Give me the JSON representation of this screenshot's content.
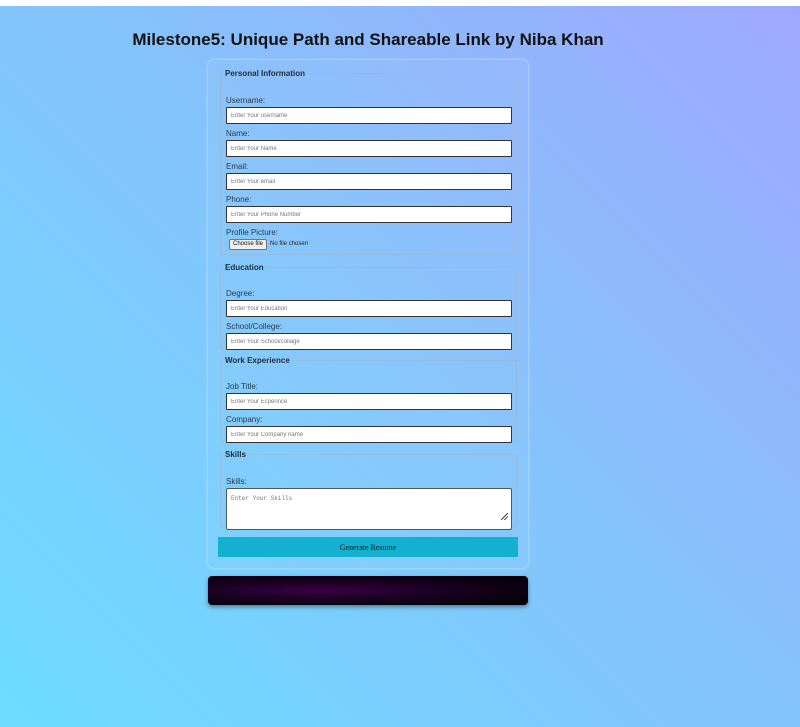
{
  "page_title": "Milestone5: Unique Path and Shareable Link by Niba Khan",
  "personal": {
    "legend": "Personal Information",
    "username_label": "Username:",
    "username_placeholder": "Enter Your username",
    "name_label": "Name:",
    "name_placeholder": "Enter Your Name",
    "email_label": "Email:",
    "email_placeholder": "Enter Your email",
    "phone_label": "Phone:",
    "phone_placeholder": "Enter Your Phone Number",
    "picture_label": "Profile Picture:",
    "choose_file": "Choose file",
    "no_file": "No file chosen"
  },
  "education": {
    "legend": "Education",
    "degree_label": "Degree:",
    "degree_placeholder": "Enter Your Education",
    "school_label": "School/College:",
    "school_placeholder": "Enter Your School/collage"
  },
  "work": {
    "legend": "Work Experience",
    "job_label": "Job Title:",
    "job_placeholder": "Enter Your Ecperince",
    "company_label": "Company:",
    "company_placeholder": "Enter Your Company name"
  },
  "skills": {
    "legend": "Skills",
    "skills_label": "Skills:",
    "skills_placeholder": "Enter Your Skills"
  },
  "generate_button": "Generate Resume",
  "colors": {
    "button": "#13b0cf",
    "output_panel": "#1a0022"
  }
}
